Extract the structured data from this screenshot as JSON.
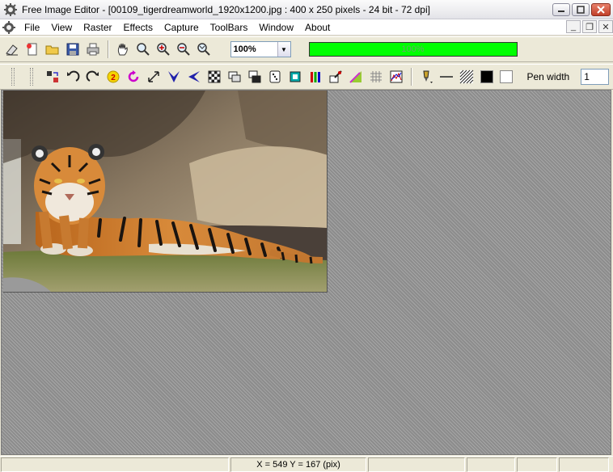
{
  "window": {
    "title": "Free Image Editor - [00109_tigerdreamworld_1920x1200.jpg : 400 x 250 pixels - 24 bit - 72 dpi]"
  },
  "menu": {
    "items": [
      {
        "label": "File"
      },
      {
        "label": "View"
      },
      {
        "label": "Raster"
      },
      {
        "label": "Effects"
      },
      {
        "label": "Capture"
      },
      {
        "label": "ToolBars"
      },
      {
        "label": "Window"
      },
      {
        "label": "About"
      }
    ]
  },
  "toolbar": {
    "zoom_value": "100%",
    "progress_text": "100%",
    "progress_fraction": 1.0,
    "progress_color": "#00ff00",
    "pen_width_label": "Pen width",
    "pen_width_value": "1",
    "primary_color": "#000000",
    "secondary_color": "#ffffff"
  },
  "status": {
    "coordinates": "X = 549   Y = 167 (pix)"
  }
}
